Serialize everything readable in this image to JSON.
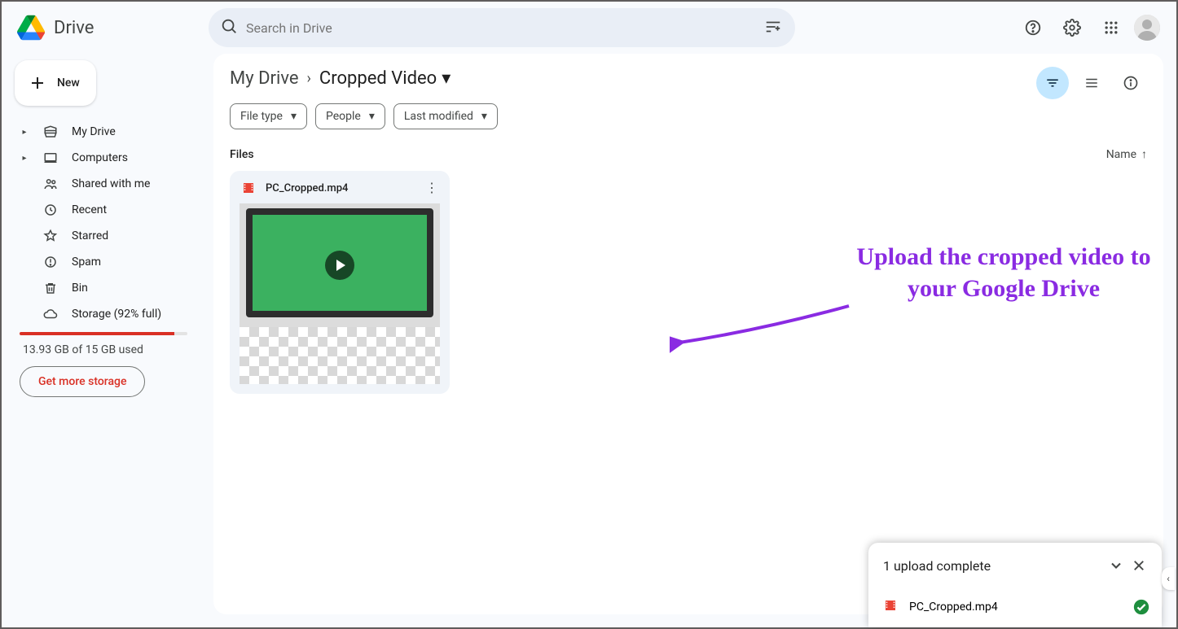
{
  "app": {
    "name": "Drive"
  },
  "search": {
    "placeholder": "Search in Drive"
  },
  "sidebar": {
    "new_label": "New",
    "items": [
      {
        "label": "My Drive",
        "icon": "mydrive",
        "expandable": true
      },
      {
        "label": "Computers",
        "icon": "computers",
        "expandable": true
      },
      {
        "label": "Shared with me",
        "icon": "shared",
        "expandable": false
      },
      {
        "label": "Recent",
        "icon": "recent",
        "expandable": false
      },
      {
        "label": "Starred",
        "icon": "star",
        "expandable": false
      },
      {
        "label": "Spam",
        "icon": "spam",
        "expandable": false
      },
      {
        "label": "Bin",
        "icon": "bin",
        "expandable": false
      },
      {
        "label": "Storage (92% full)",
        "icon": "cloud",
        "expandable": false
      }
    ],
    "storage_pct": 92,
    "storage_text": "13.93 GB of 15 GB used",
    "more_storage": "Get more storage"
  },
  "breadcrumb": {
    "root": "My Drive",
    "current": "Cropped Video"
  },
  "filters": {
    "file_type": "File type",
    "people": "People",
    "last_modified": "Last modified"
  },
  "section": {
    "title": "Files",
    "sort_label": "Name"
  },
  "file": {
    "name": "PC_Cropped.mp4"
  },
  "annotation": {
    "text": "Upload the cropped video to your Google Drive"
  },
  "toast": {
    "title": "1 upload complete",
    "file": "PC_Cropped.mp4"
  }
}
